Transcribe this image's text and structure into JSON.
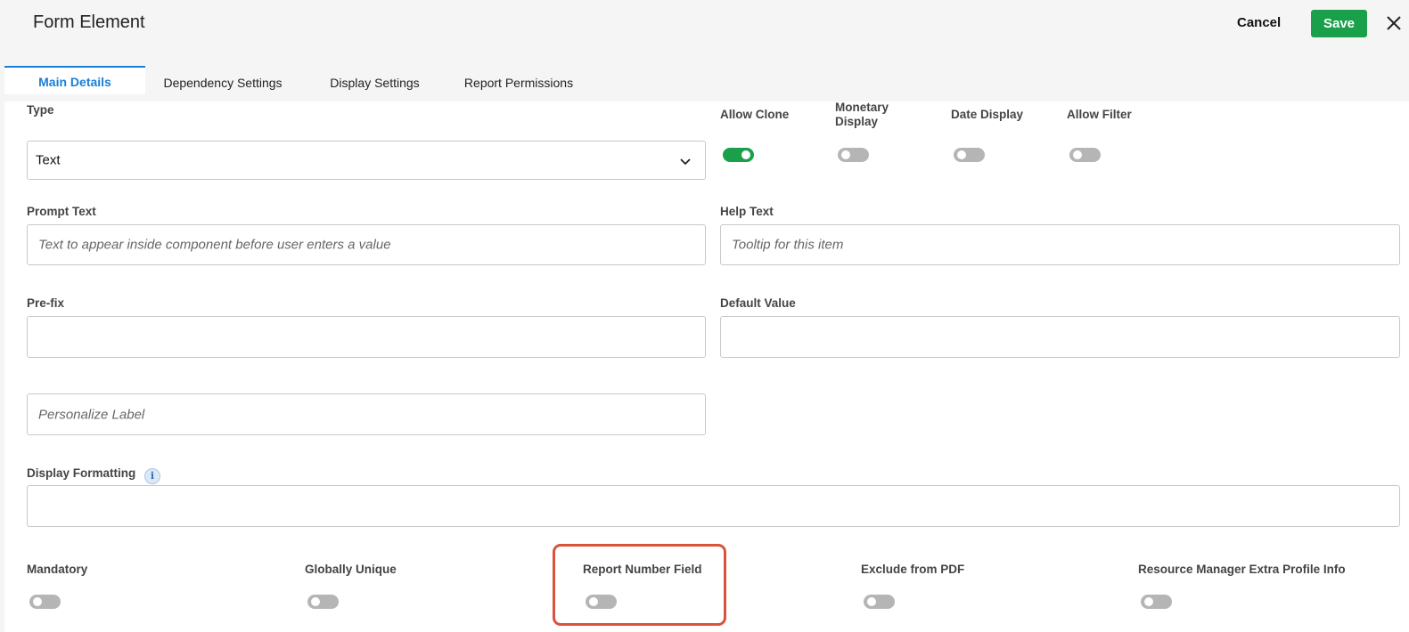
{
  "header": {
    "title": "Form Element",
    "cancel_label": "Cancel",
    "save_label": "Save",
    "close_icon": "close-icon"
  },
  "tabs": [
    {
      "label": "Main Details",
      "active": true
    },
    {
      "label": "Dependency Settings",
      "active": false
    },
    {
      "label": "Display Settings",
      "active": false
    },
    {
      "label": "Report Permissions",
      "active": false
    }
  ],
  "form": {
    "type": {
      "label": "Type",
      "value": "Text"
    },
    "prompt_text": {
      "label": "Prompt Text",
      "placeholder": "Text to appear inside component before user enters a value"
    },
    "help_text": {
      "label": "Help Text",
      "placeholder": "Tooltip for this item"
    },
    "prefix": {
      "label": "Pre-fix",
      "value": ""
    },
    "default_value": {
      "label": "Default Value",
      "value": ""
    },
    "personalize_label": {
      "placeholder": "Personalize Label"
    },
    "display_formatting": {
      "label": "Display Formatting",
      "value": ""
    }
  },
  "top_toggles": [
    {
      "label": "Allow Clone",
      "on": true
    },
    {
      "label": "Monetary Display",
      "on": false
    },
    {
      "label": "Date Display",
      "on": false
    },
    {
      "label": "Allow Filter",
      "on": false
    }
  ],
  "bottom_toggles": [
    {
      "label": "Mandatory",
      "on": false
    },
    {
      "label": "Globally Unique",
      "on": false
    },
    {
      "label": "Report Number Field",
      "on": false
    },
    {
      "label": "Exclude from PDF",
      "on": false
    },
    {
      "label": "Resource Manager Extra Profile Info",
      "on": false
    }
  ],
  "colors": {
    "accent": "#1a7fd8",
    "save": "#1aa04a",
    "highlight": "#d9533c",
    "toggle_off": "#b5b5b5"
  }
}
